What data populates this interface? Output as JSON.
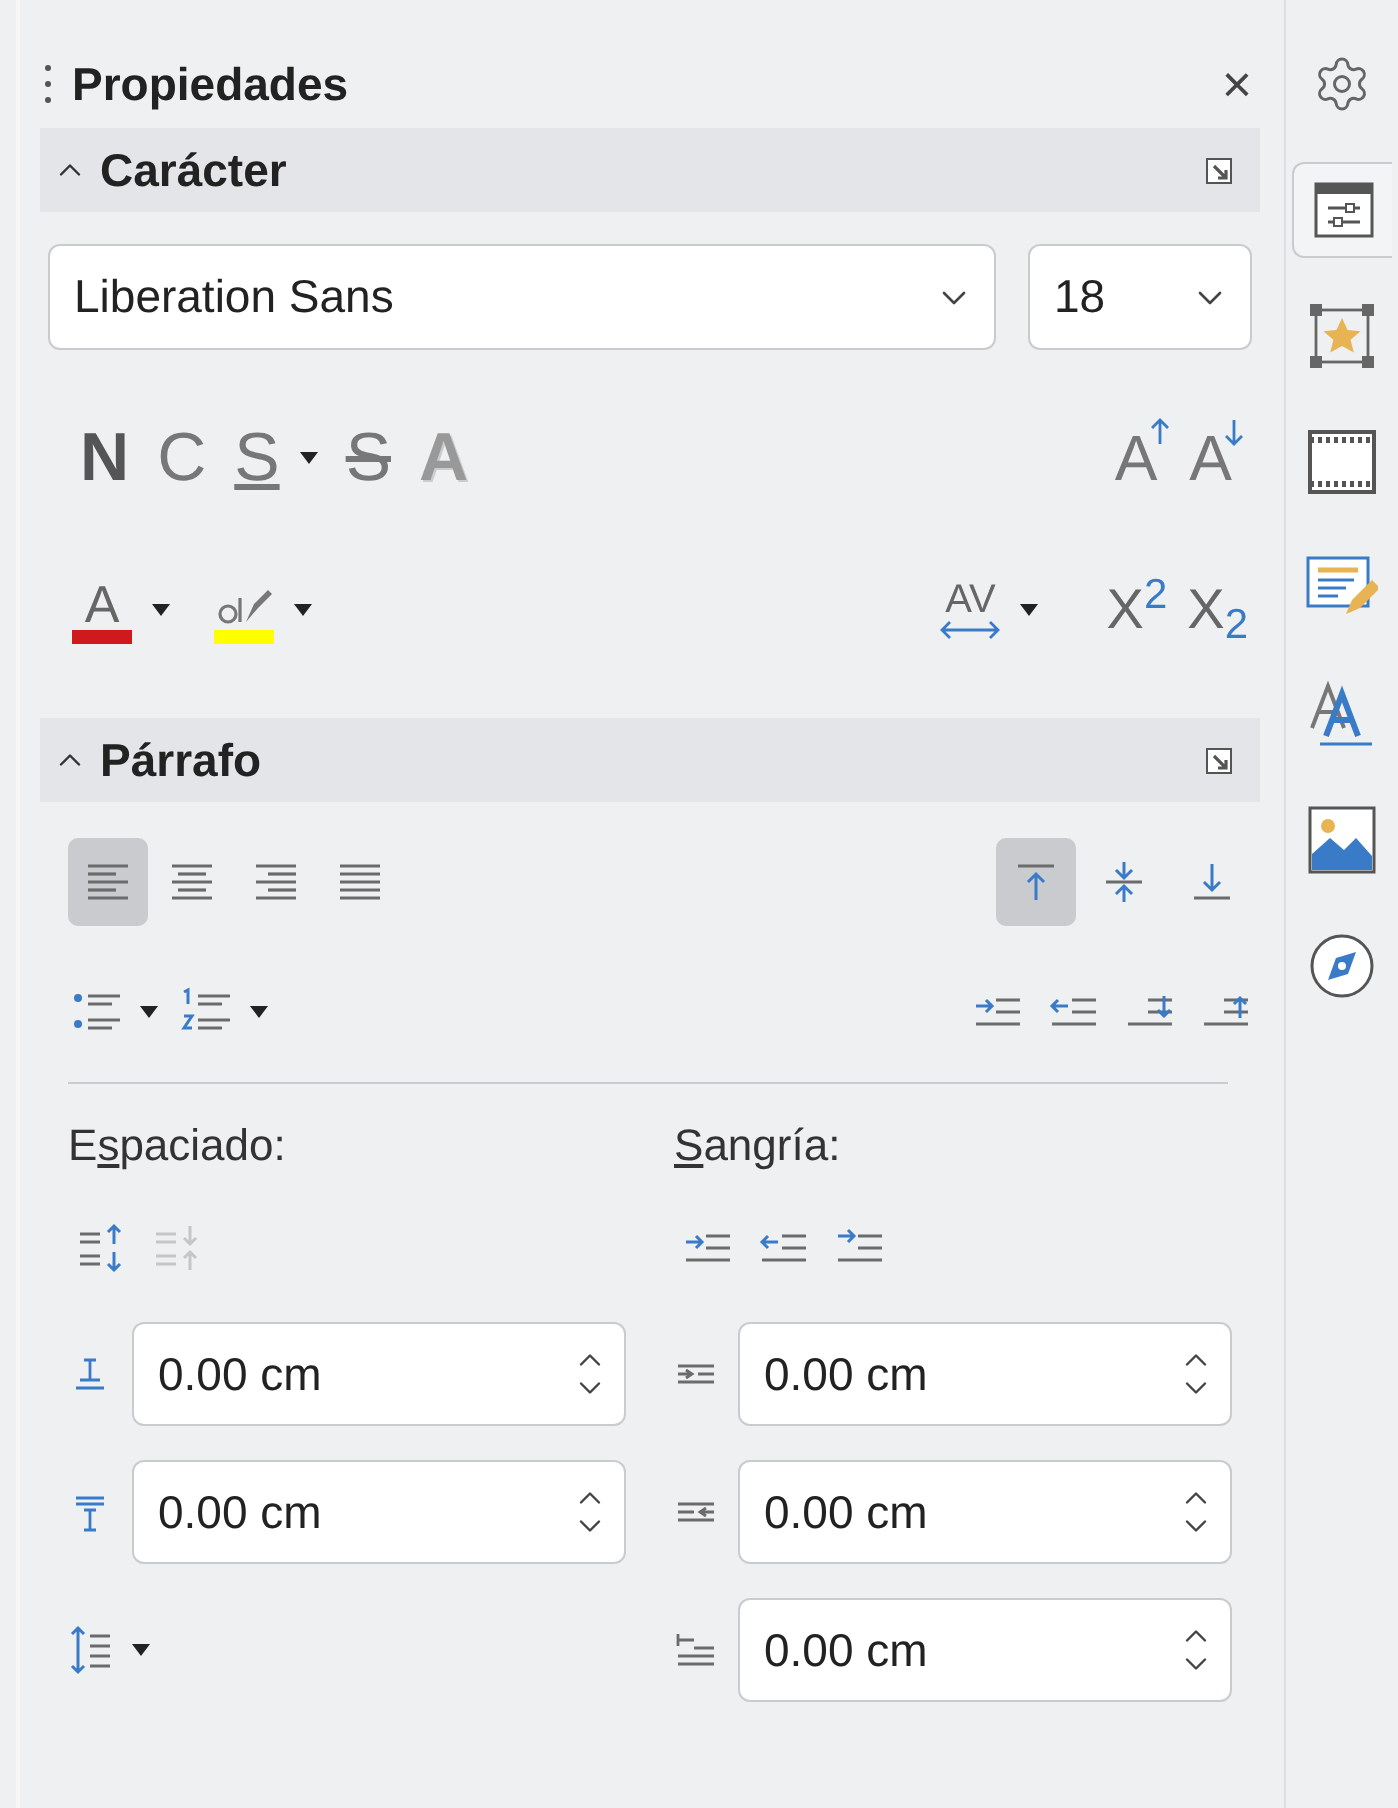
{
  "panel": {
    "title": "Propiedades",
    "close": "×"
  },
  "character": {
    "title": "Carácter",
    "expanded": true,
    "font": {
      "value": "Liberation Sans"
    },
    "size": {
      "value": "18"
    },
    "format_buttons": [
      {
        "kind": "bold",
        "label": "N"
      },
      {
        "kind": "italic",
        "label": "C"
      },
      {
        "kind": "underline",
        "label": "S"
      },
      {
        "kind": "strike",
        "label": "S"
      },
      {
        "kind": "shadow",
        "label": "A"
      }
    ],
    "size_buttons": [
      {
        "kind": "grow",
        "label": "A"
      },
      {
        "kind": "shrink",
        "label": "A"
      }
    ],
    "color_buttons": [
      {
        "kind": "font-color",
        "label": "A",
        "color": "#d0191c"
      },
      {
        "kind": "highlight",
        "color": "#ffff00"
      }
    ],
    "spacing_button": {
      "label": "AV"
    },
    "script_buttons": [
      {
        "label": "X$^{2}$"
      },
      {
        "label": "X$_{2}$"
      }
    ]
  },
  "paragraph": {
    "title": "Párrafo",
    "expanded": true,
    "align_buttons": [
      {
        "kind": "left",
        "selected": true
      },
      {
        "kind": "center",
        "selected": false
      },
      {
        "kind": "right",
        "selected": false
      },
      {
        "kind": "justify",
        "selected": false
      }
    ],
    "valign_buttons": [
      {
        "kind": "top",
        "selected": true
      },
      {
        "kind": "middle",
        "selected": false
      },
      {
        "kind": "bottom",
        "selected": false
      }
    ],
    "list_buttons": [
      {
        "kind": "bullets"
      },
      {
        "kind": "numbers"
      }
    ],
    "indent_buttons": [
      {
        "kind": "increase"
      },
      {
        "kind": "decrease"
      },
      {
        "kind": "spacing-down"
      },
      {
        "kind": "spacing-up"
      }
    ],
    "spacing": {
      "label_before": "E",
      "mnemonic": "s",
      "label_after": "paciado:",
      "buttons": [
        {
          "kind": "increase",
          "disabled": false
        },
        {
          "kind": "decrease",
          "disabled": true
        }
      ],
      "fields": [
        {
          "kind": "above",
          "value": "0.00 cm"
        },
        {
          "kind": "below",
          "value": "0.00 cm"
        }
      ]
    },
    "indent": {
      "mnemonic": "S",
      "label_after": "angría:",
      "buttons": [
        {
          "kind": "increase"
        },
        {
          "kind": "decrease"
        },
        {
          "kind": "hanging"
        }
      ],
      "fields": [
        {
          "kind": "before",
          "value": "0.00 cm"
        },
        {
          "kind": "after",
          "value": "0.00 cm"
        },
        {
          "kind": "first",
          "value": "0.00 cm"
        }
      ]
    }
  },
  "sidebar": [
    {
      "kind": "settings",
      "selected": false
    },
    {
      "kind": "properties",
      "selected": true
    },
    {
      "kind": "gallery",
      "selected": false
    },
    {
      "kind": "slides",
      "selected": false
    },
    {
      "kind": "changes",
      "selected": false
    },
    {
      "kind": "styles",
      "selected": false
    },
    {
      "kind": "image",
      "selected": false
    },
    {
      "kind": "navigator",
      "selected": false
    }
  ]
}
